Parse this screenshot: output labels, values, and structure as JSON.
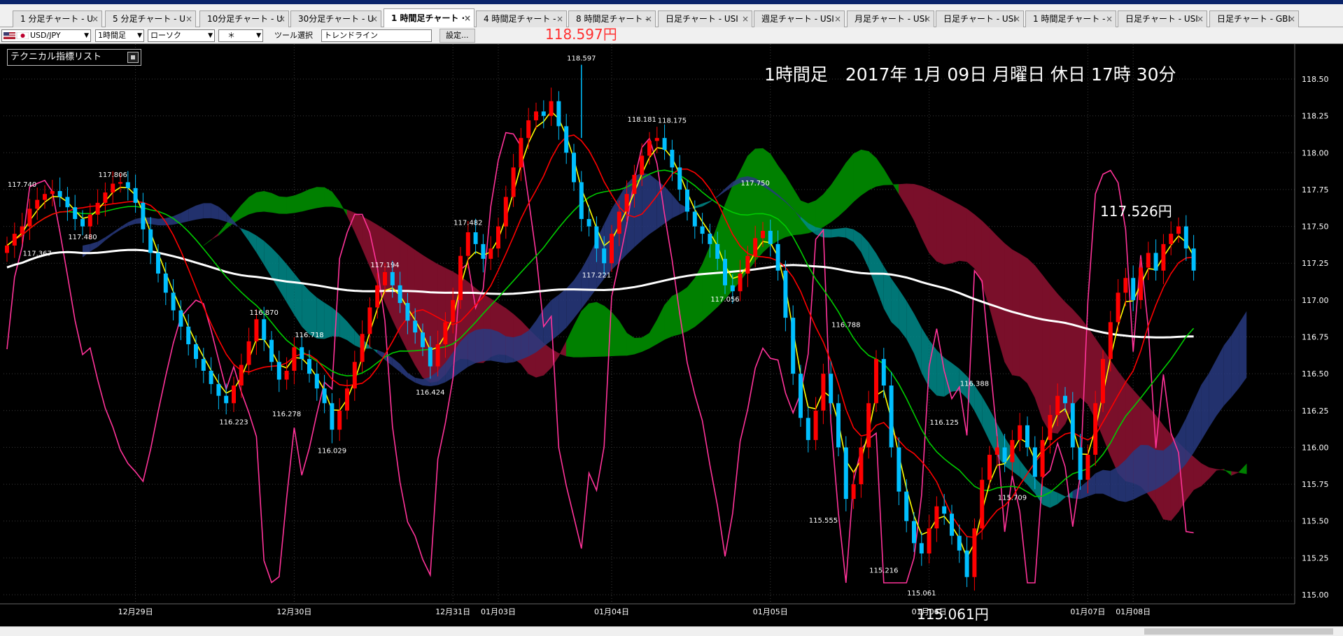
{
  "tabs": [
    {
      "label": "1 分足チャート - U"
    },
    {
      "label": "5 分足チャート - U"
    },
    {
      "label": "10分足チャート - U"
    },
    {
      "label": "30分足チャート - U"
    },
    {
      "label": "1 時間足チャート ·",
      "active": true
    },
    {
      "label": "4 時間足チャート -"
    },
    {
      "label": "8 時間足チャート -"
    },
    {
      "label": "日足チャート - USI"
    },
    {
      "label": "週足チャート - USI"
    },
    {
      "label": "月足チャート - USI"
    },
    {
      "label": "日足チャート - USI"
    },
    {
      "label": "1 時間足チャート -"
    },
    {
      "label": "日足チャート - USI"
    },
    {
      "label": "日足チャート - GBI"
    }
  ],
  "toolbar": {
    "symbol": "USD/JPY",
    "timeframe": "1時間足",
    "chart_style": "ローソク",
    "marker": "＊",
    "tool_label": "ツール選択",
    "tool_value": "トレンドライン",
    "settings_button": "設定..."
  },
  "indicator_list": "テクニカル指標リスト",
  "headline": "1時間足　2017年 1月 09日 月曜日 休日 17時 30分",
  "high_price": "118.597円",
  "last_price": "117.526円",
  "low_price": "115.061円",
  "colors": {
    "background": "#000000",
    "bull_candle": "#ff0000",
    "bear_candle": "#00bfff",
    "kumo_bull": "#008000",
    "kumo_bear": "#7a0f2a",
    "kumo_teal": "#008b8b",
    "kumo_navy": "#283a80",
    "sma_long": "#ffffff",
    "rsi": "#ff3399",
    "ma_fast": "#ffff00",
    "ma_mid": "#ff0000",
    "ma_slow": "#00cc00"
  },
  "chart_data": {
    "type": "candlestick",
    "symbol": "USD/JPY",
    "timeframe": "1時間足",
    "ylim": [
      114.95,
      118.62
    ],
    "yticks": [
      "118.50",
      "118.25",
      "118.00",
      "117.75",
      "117.50",
      "117.25",
      "117.00",
      "116.75",
      "116.50",
      "116.25",
      "116.00",
      "115.75",
      "115.50",
      "115.25",
      "115.00"
    ],
    "xlabels": [
      {
        "label": "12月29日",
        "bar": 17
      },
      {
        "label": "12月30日",
        "bar": 38
      },
      {
        "label": "12月31日",
        "bar": 59
      },
      {
        "label": "01月03日",
        "bar": 65
      },
      {
        "label": "01月04日",
        "bar": 80
      },
      {
        "label": "01月05日",
        "bar": 101
      },
      {
        "label": "01月06日",
        "bar": 122
      },
      {
        "label": "01月07日",
        "bar": 143
      },
      {
        "label": "01月08日",
        "bar": 149
      }
    ],
    "close": [
      117.37,
      117.45,
      117.5,
      117.62,
      117.68,
      117.72,
      117.74,
      117.7,
      117.63,
      117.55,
      117.5,
      117.58,
      117.66,
      117.73,
      117.79,
      117.8,
      117.76,
      117.66,
      117.48,
      117.32,
      117.18,
      117.05,
      116.93,
      116.82,
      116.7,
      116.6,
      116.52,
      116.43,
      116.35,
      116.3,
      116.42,
      116.56,
      116.72,
      116.87,
      116.73,
      116.58,
      116.46,
      116.52,
      116.68,
      116.6,
      116.5,
      116.4,
      116.3,
      116.12,
      116.25,
      116.4,
      116.58,
      116.77,
      116.95,
      117.1,
      117.19,
      117.1,
      116.98,
      116.86,
      116.78,
      116.68,
      116.55,
      116.7,
      116.85,
      117.0,
      117.3,
      117.46,
      117.38,
      117.28,
      117.35,
      117.5,
      117.7,
      117.9,
      118.1,
      118.22,
      118.28,
      118.25,
      118.35,
      118.18,
      118.0,
      117.8,
      117.55,
      117.5,
      117.35,
      117.25,
      117.45,
      117.6,
      117.72,
      117.85,
      117.98,
      118.08,
      118.1,
      118.02,
      117.9,
      117.75,
      117.6,
      117.5,
      117.45,
      117.38,
      117.28,
      117.1,
      117.06,
      117.18,
      117.3,
      117.42,
      117.47,
      117.38,
      117.2,
      116.88,
      116.5,
      116.2,
      116.05,
      116.25,
      116.5,
      116.3,
      116.0,
      115.65,
      115.75,
      116.0,
      116.3,
      116.6,
      116.42,
      116.0,
      115.7,
      115.5,
      115.35,
      115.28,
      115.45,
      115.6,
      115.55,
      115.4,
      115.3,
      115.12,
      115.45,
      115.78,
      115.95,
      116.0,
      115.9,
      116.05,
      116.15,
      116.0,
      115.8,
      116.05,
      116.22,
      116.35,
      116.3,
      116.0,
      115.78,
      115.95,
      116.3,
      116.6,
      116.85,
      117.05,
      117.15,
      117.0,
      117.22,
      117.32,
      117.2,
      117.38,
      117.45,
      117.5,
      117.35,
      117.2
    ],
    "points": [
      {
        "label": "117.740",
        "bar": 2,
        "value": 117.74
      },
      {
        "label": "117.806",
        "bar": 14,
        "value": 117.806
      },
      {
        "label": "117.480",
        "bar": 10,
        "value": 117.48,
        "below": true
      },
      {
        "label": "117.367",
        "bar": 4,
        "value": 117.367,
        "below": true
      },
      {
        "label": "116.223",
        "bar": 30,
        "value": 116.223,
        "below": true
      },
      {
        "label": "116.870",
        "bar": 34,
        "value": 116.87
      },
      {
        "label": "116.278",
        "bar": 37,
        "value": 116.278,
        "below": true
      },
      {
        "label": "116.718",
        "bar": 40,
        "value": 116.718
      },
      {
        "label": "116.029",
        "bar": 43,
        "value": 116.029,
        "below": true
      },
      {
        "label": "117.194",
        "bar": 50,
        "value": 117.194
      },
      {
        "label": "116.424",
        "bar": 56,
        "value": 116.424,
        "below": true
      },
      {
        "label": "117.482",
        "bar": 61,
        "value": 117.482
      },
      {
        "label": "118.597",
        "bar": 76,
        "value": 118.597
      },
      {
        "label": "118.181",
        "bar": 84,
        "value": 118.181
      },
      {
        "label": "118.175",
        "bar": 88,
        "value": 118.175
      },
      {
        "label": "117.221",
        "bar": 78,
        "value": 117.221,
        "below": true
      },
      {
        "label": "117.750",
        "bar": 99,
        "value": 117.75
      },
      {
        "label": "117.056",
        "bar": 95,
        "value": 117.056,
        "below": true
      },
      {
        "label": "116.788",
        "bar": 111,
        "value": 116.788
      },
      {
        "label": "115.555",
        "bar": 108,
        "value": 115.555,
        "below": true
      },
      {
        "label": "115.216",
        "bar": 116,
        "value": 115.216,
        "below": true
      },
      {
        "label": "115.061",
        "bar": 121,
        "value": 115.061,
        "below": true
      },
      {
        "label": "116.125",
        "bar": 124,
        "value": 116.125
      },
      {
        "label": "116.388",
        "bar": 128,
        "value": 116.388
      },
      {
        "label": "115.709",
        "bar": 133,
        "value": 115.709,
        "below": true
      }
    ]
  }
}
